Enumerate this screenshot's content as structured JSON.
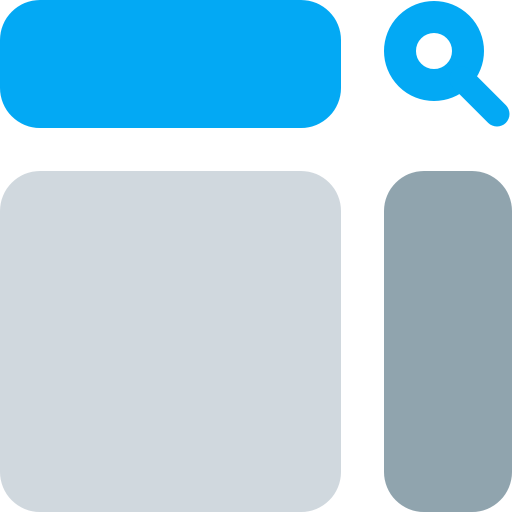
{
  "icon": {
    "name": "search-layout-icon",
    "colors": {
      "accent": "#03A9F4",
      "main_panel": "#D0D8DE",
      "side_panel": "#90A4AE",
      "background": "#FFFFFF"
    },
    "parts": {
      "search_bar": "search-bar",
      "search_button": "magnifier-icon",
      "main_panel": "content-panel",
      "side_panel": "sidebar-panel"
    }
  }
}
